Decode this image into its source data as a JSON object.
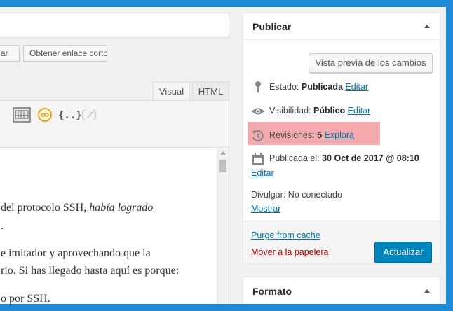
{
  "editor": {
    "partial_button_label": "ar",
    "shortlink_button_label": "Obtener enlace corto",
    "tabs": {
      "visual": "Visual",
      "html": "HTML"
    },
    "toolbar_icons": [
      "keyboard-icon",
      "infinity-icon",
      "code-braces-icon",
      "disabled-link-icon"
    ],
    "code_label": "{..}",
    "lines": [
      {
        "pre": "del protocolo SSH, ",
        "em": "había logrado"
      },
      {
        "pre": "."
      },
      {
        "pre": "e imitador y aprovechando que la"
      },
      {
        "pre": "rio. Si has llegado hasta aquí es porque:"
      },
      {
        "pre": "o por SSH."
      }
    ]
  },
  "publish": {
    "title": "Publicar",
    "preview_label": "Vista previa de los cambios",
    "estado": {
      "label": "Estado:",
      "value": "Publicada",
      "link": "Editar"
    },
    "visibilidad": {
      "label": "Visibilidad:",
      "value": "Público",
      "link": "Editar"
    },
    "revisiones": {
      "label": "Revisiones:",
      "value": "5",
      "link": "Explora"
    },
    "fecha": {
      "label": "Publicada el:",
      "value": "30 Oct de 2017 @ 08:10",
      "link": "Editar"
    },
    "divulgar": {
      "label": "Divulgar: No conectado",
      "link": "Mostrar"
    },
    "purge_label": "Purge from cache",
    "trash_label": "Mover a la papelera",
    "update_label": "Actualizar",
    "highlight_color": "#f4a9ad",
    "primary_color": "#0085ba"
  },
  "format": {
    "title": "Formato"
  }
}
